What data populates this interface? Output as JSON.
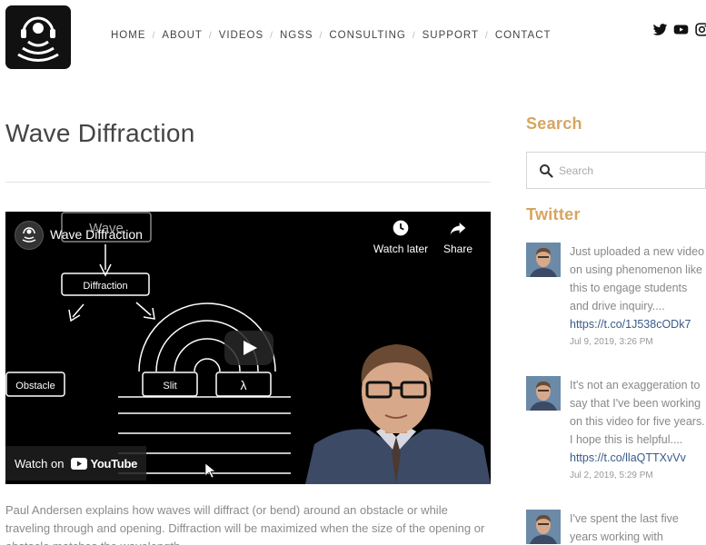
{
  "nav": {
    "items": [
      "HOME",
      "ABOUT",
      "VIDEOS",
      "NGSS",
      "CONSULTING",
      "SUPPORT",
      "CONTACT"
    ]
  },
  "social": {
    "icons": [
      "twitter-icon",
      "youtube-icon",
      "instagram-icon"
    ]
  },
  "page": {
    "title": "Wave Diffraction"
  },
  "video": {
    "title": "Wave Diffraction",
    "watch_later": "Watch later",
    "share": "Share",
    "watch_on": "Watch on",
    "youtube": "YouTube",
    "diagram": {
      "wave": "Wave",
      "diffraction": "Diffraction",
      "obstacle": "Obstacle",
      "slit": "Slit",
      "lambda": "λ"
    }
  },
  "description": "Paul Andersen explains how waves will diffract (or bend) around an obstacle or while traveling through and opening. Diffraction will be maximized when the size of the opening or obstacle matches the wavelength.",
  "sidebar": {
    "search_heading": "Search",
    "search_placeholder": "Search",
    "search_value": "",
    "twitter_heading": "Twitter",
    "tweets": [
      {
        "text": "Just uploaded a new video on using phenomenon like this to engage students and drive inquiry....",
        "link": "https://t.co/1J538cODk7",
        "date": "Jul 9, 2019, 3:26 PM"
      },
      {
        "text": "It's not an exaggeration to say that I've been working on this video for five years. I hope this is helpful....",
        "link": "https://t.co/llaQTTXvVv",
        "date": "Jul 2, 2019, 5:29 PM"
      },
      {
        "text": "I've spent the last five years working with",
        "link": "",
        "date": ""
      }
    ]
  },
  "colors": {
    "accent": "#d6a55f",
    "link": "#3a5a8a"
  }
}
